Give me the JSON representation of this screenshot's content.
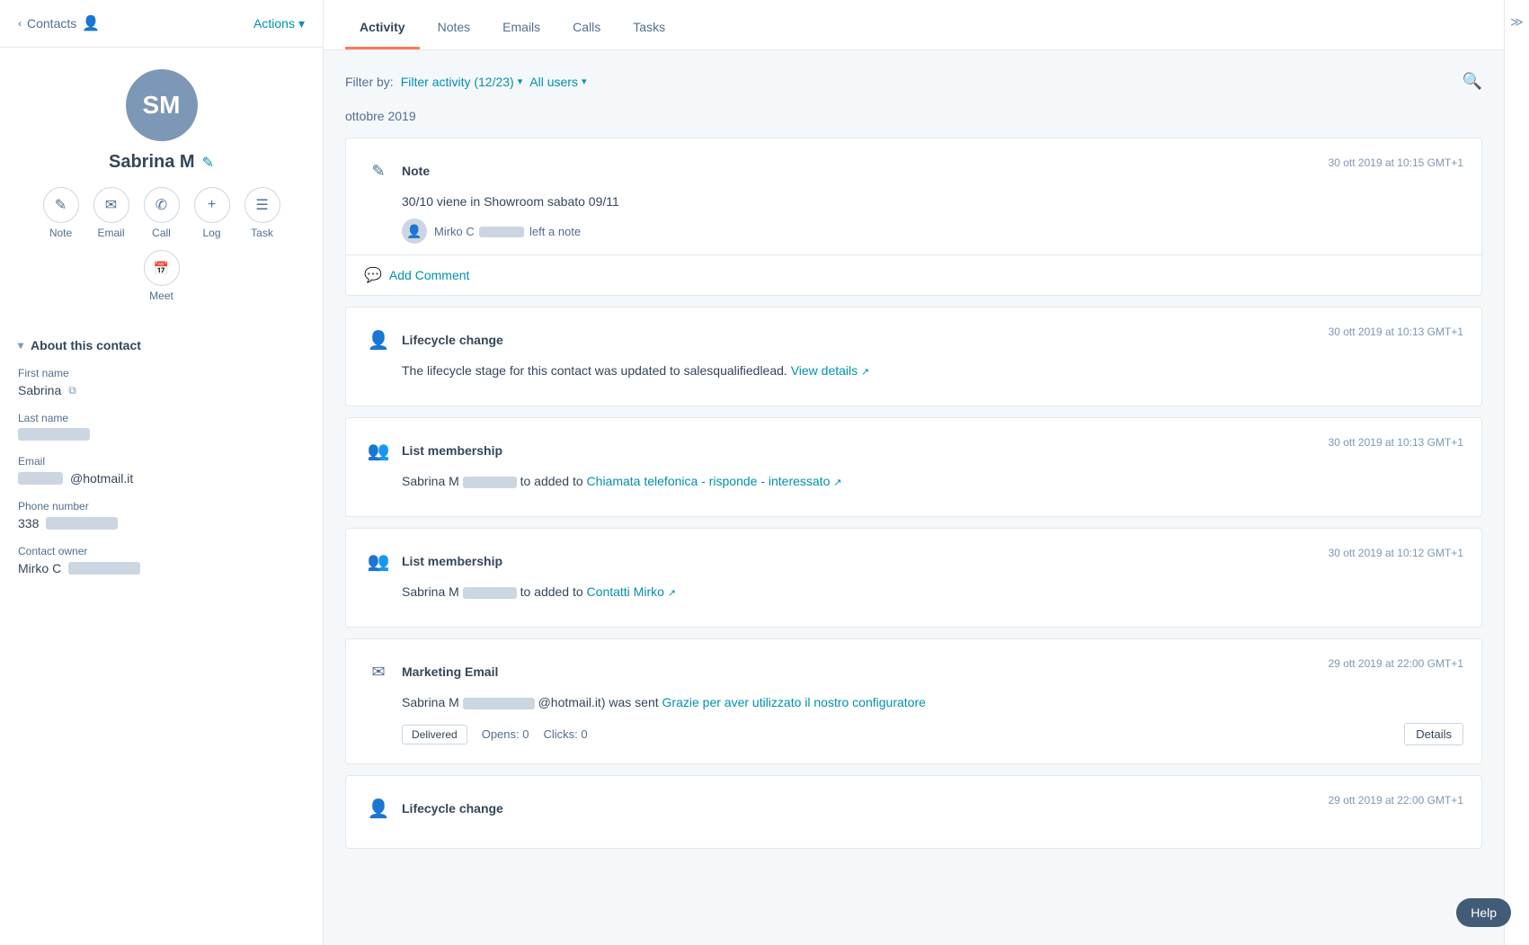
{
  "sidebar": {
    "back_label": "Contacts",
    "actions_label": "Actions",
    "avatar_initials": "SM",
    "contact_name": "Sabrina M",
    "action_buttons": [
      {
        "label": "Note",
        "icon": "✎"
      },
      {
        "label": "Email",
        "icon": "✉"
      },
      {
        "label": "Call",
        "icon": "✆"
      },
      {
        "label": "Log",
        "icon": "+"
      },
      {
        "label": "Task",
        "icon": "☰"
      },
      {
        "label": "Meet",
        "icon": "📅"
      }
    ],
    "section_title": "About this contact",
    "fields": [
      {
        "label": "First name",
        "value": "Sabrina",
        "blurred": false
      },
      {
        "label": "Last name",
        "value": "",
        "blurred": true
      },
      {
        "label": "Email",
        "value": "@hotmail.it",
        "blurred_prefix": true
      },
      {
        "label": "Phone number",
        "value": "338",
        "blurred_suffix": true
      },
      {
        "label": "Contact owner",
        "value": "Mirko C",
        "blurred_suffix": true
      }
    ]
  },
  "tabs": [
    {
      "label": "Activity",
      "active": true
    },
    {
      "label": "Notes",
      "active": false
    },
    {
      "label": "Emails",
      "active": false
    },
    {
      "label": "Calls",
      "active": false
    },
    {
      "label": "Tasks",
      "active": false
    }
  ],
  "filter_bar": {
    "label": "Filter by:",
    "filter_activity_label": "Filter activity (12/23)",
    "all_users_label": "All users"
  },
  "month_label": "ottobre 2019",
  "activities": [
    {
      "type": "note",
      "icon": "✎",
      "title": "Note",
      "timestamp": "30 ott 2019 at 10:15 GMT+1",
      "body": "30/10 viene in Showroom sabato 09/11",
      "user_left_note": "left a note",
      "user_name": "Mirko C",
      "has_comment": true,
      "add_comment_label": "Add Comment"
    },
    {
      "type": "lifecycle",
      "icon": "👤",
      "title": "Lifecycle change",
      "timestamp": "30 ott 2019 at 10:13 GMT+1",
      "body_pre": "The lifecycle stage for this contact was updated to salesqualifiedlead.",
      "body_link": "View details",
      "has_comment": false
    },
    {
      "type": "list",
      "icon": "👥",
      "title": "List membership",
      "timestamp": "30 ott 2019 at 10:13 GMT+1",
      "body_pre": "Sabrina M",
      "body_mid": "to added to",
      "body_link": "Chiamata telefonica - risponde - interessato",
      "has_comment": false
    },
    {
      "type": "list",
      "icon": "👥",
      "title": "List membership",
      "timestamp": "30 ott 2019 at 10:12 GMT+1",
      "body_pre": "Sabrina M",
      "body_mid": "to added to",
      "body_link": "Contatti Mirko",
      "has_comment": false
    },
    {
      "type": "email",
      "icon": "✉",
      "title": "Marketing Email",
      "timestamp": "29 ott 2019 at 22:00 GMT+1",
      "body_pre": "Sabrina M",
      "body_email": "@hotmail.it) was sent",
      "body_link": "Grazie per aver utilizzato il nostro configuratore",
      "delivered_label": "Delivered",
      "opens_label": "Opens: 0",
      "clicks_label": "Clicks: 0",
      "details_label": "Details",
      "has_comment": false
    },
    {
      "type": "lifecycle",
      "icon": "👤",
      "title": "Lifecycle change",
      "timestamp": "29 ott 2019 at 22:00 GMT+1",
      "body_pre": "",
      "has_comment": false
    }
  ],
  "help_label": "Help"
}
